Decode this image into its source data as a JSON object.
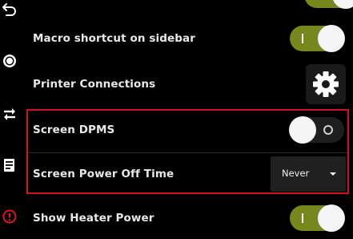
{
  "sidebar": {
    "icons": [
      "back-arrow-icon",
      "circle-icon",
      "swap-arrows-icon",
      "list-icon",
      "alert-icon"
    ],
    "alert_color": "#e0141c"
  },
  "settings": [
    {
      "label": "Macro shortcut on sidebar",
      "control": "toggle",
      "state": "on"
    },
    {
      "label": "Printer Connections",
      "control": "button",
      "icon": "gear-icon"
    },
    {
      "label": "Screen DPMS",
      "control": "toggle",
      "state": "off"
    },
    {
      "label": "Screen Power Off Time",
      "control": "select",
      "value": "Never"
    },
    {
      "label": "Show Heater Power",
      "control": "toggle",
      "state": "on"
    }
  ],
  "colors": {
    "toggle_on": "#76881d",
    "toggle_off": "#1e1e1e",
    "highlight": "#d0141c"
  }
}
